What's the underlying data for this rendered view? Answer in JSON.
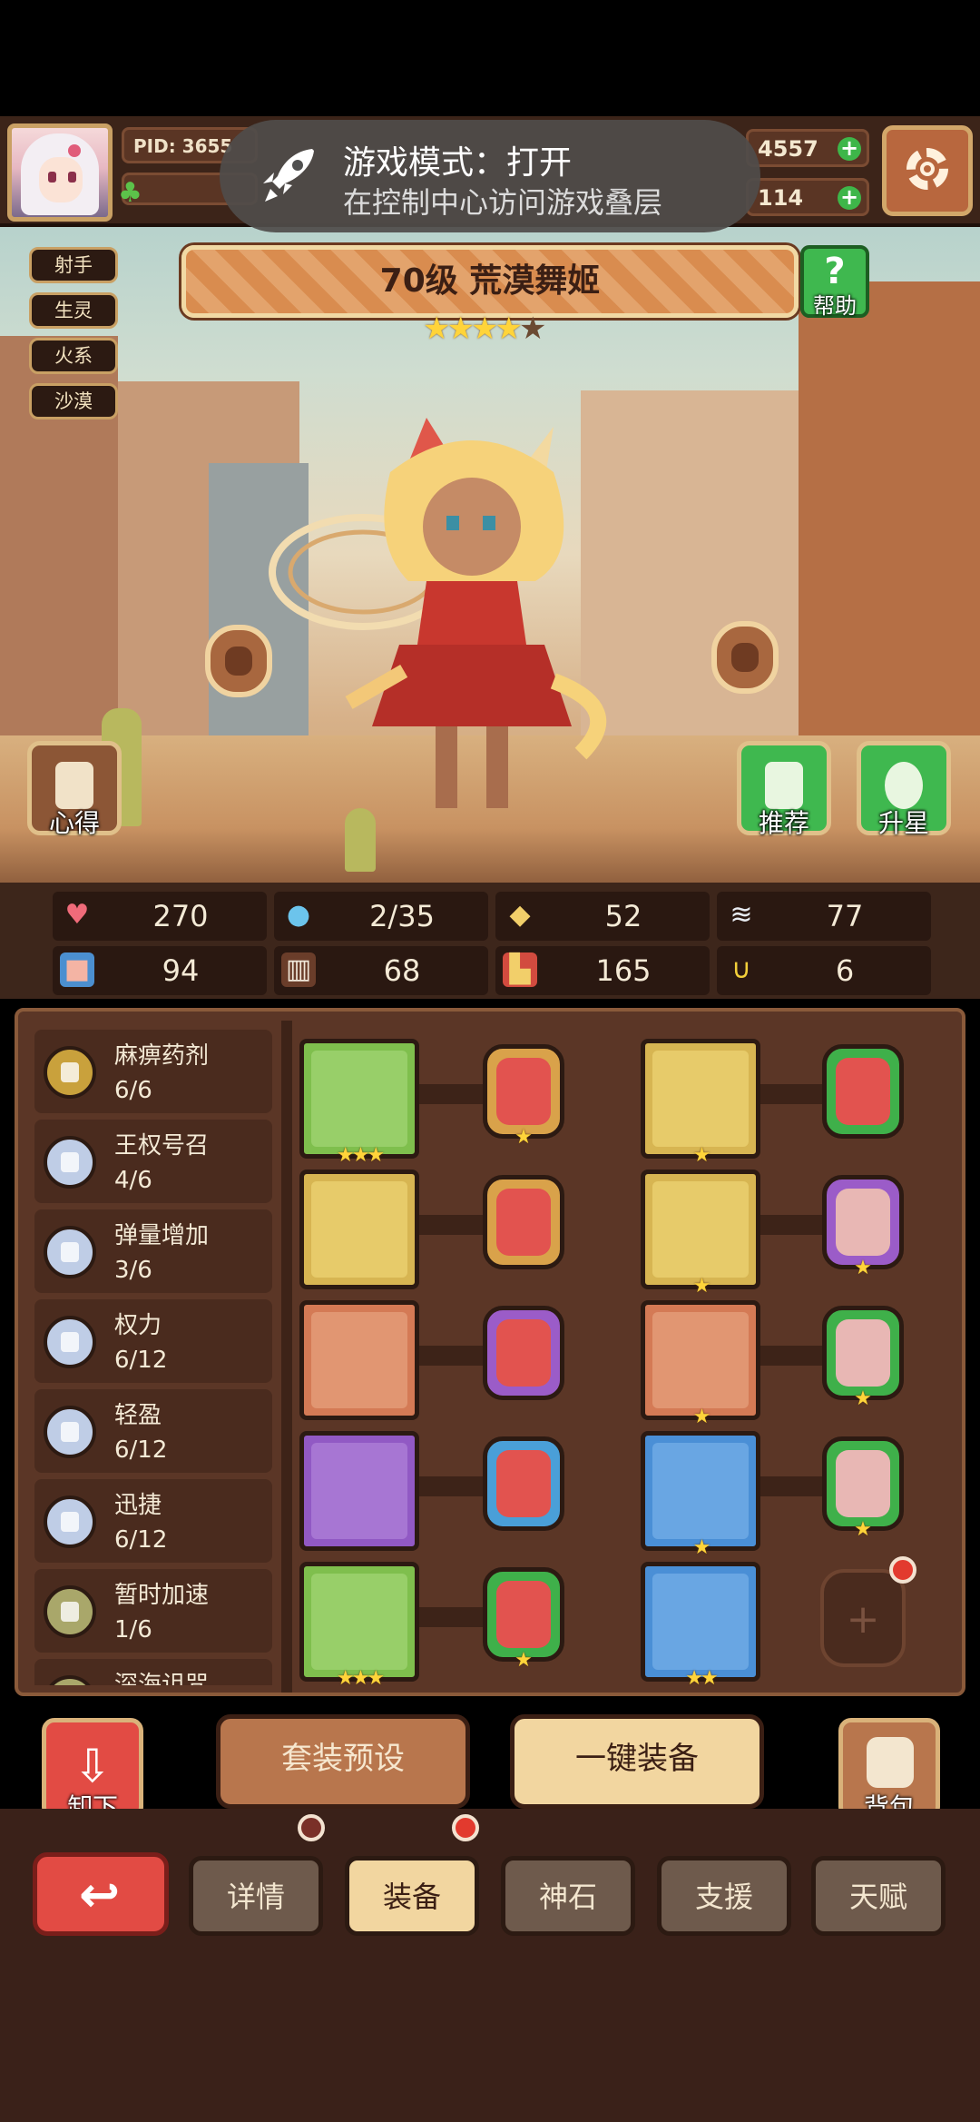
{
  "toast": {
    "title": "游戏模式：打开",
    "subtitle": "在控制中心访问游戏叠层"
  },
  "header": {
    "pid": "PID: 3655",
    "currency1": "4557",
    "currency2": "114"
  },
  "character": {
    "tags": [
      "射手",
      "生灵",
      "火系",
      "沙漠"
    ],
    "title": "70级 荒漠舞姬",
    "stars_filled": 4,
    "stars_total": 5,
    "help_label": "帮助",
    "insight_label": "心得",
    "recommend_label": "推荐",
    "upgrade_label": "升星"
  },
  "stats": [
    {
      "icon": "heart-icon",
      "value": "270"
    },
    {
      "icon": "water-drop-icon",
      "value": "2/35"
    },
    {
      "icon": "shield-icon",
      "value": "52"
    },
    {
      "icon": "wing-icon",
      "value": "77"
    },
    {
      "icon": "fist-icon",
      "value": "94"
    },
    {
      "icon": "book-icon",
      "value": "68"
    },
    {
      "icon": "boot-icon",
      "value": "165"
    },
    {
      "icon": "horseshoe-icon",
      "value": "6"
    }
  ],
  "skills": [
    {
      "name": "麻痹药剂",
      "count": "6/6",
      "color": "#c9a13c"
    },
    {
      "name": "王权号召",
      "count": "4/6",
      "color": "#bfcde6"
    },
    {
      "name": "弹量增加",
      "count": "3/6",
      "color": "#bfcde6"
    },
    {
      "name": "权力",
      "count": "6/12",
      "color": "#bfcde6"
    },
    {
      "name": "轻盈",
      "count": "6/12",
      "color": "#bfcde6"
    },
    {
      "name": "迅捷",
      "count": "6/12",
      "color": "#bfcde6"
    },
    {
      "name": "暂时加速",
      "count": "1/6",
      "color": "#a9a76a"
    },
    {
      "name": "深海诅咒",
      "count": "",
      "color": "#a9a76a"
    }
  ],
  "equipment": [
    {
      "item": "wand-icon",
      "frame": "#7fbf4d",
      "inner": "#9ad06a",
      "stars": "★★★",
      "gem_border": "#d9a24a",
      "gem": "#e2534f",
      "gem_star": "★"
    },
    {
      "item": "crown-icon",
      "frame": "#d7b552",
      "inner": "#e8cc6c",
      "stars": "★",
      "gem_border": "#3fb04a",
      "gem": "#e2534f",
      "gem_star": ""
    },
    {
      "item": "spear-icon",
      "frame": "#d7b552",
      "inner": "#e8cc6c",
      "stars": "",
      "gem_border": "#d9a24a",
      "gem": "#e2534f",
      "gem_star": ""
    },
    {
      "item": "robe-icon",
      "frame": "#d7b552",
      "inner": "#e8cc6c",
      "stars": "★",
      "gem_border": "#9b5cc8",
      "gem": "#e8b7b4",
      "gem_star": "★"
    },
    {
      "item": "necklace-icon",
      "frame": "#d47a55",
      "inner": "#e29874",
      "stars": "",
      "gem_border": "#9b5cc8",
      "gem": "#e2534f",
      "gem_star": ""
    },
    {
      "item": "ring-icon",
      "frame": "#d47a55",
      "inner": "#e29874",
      "stars": "★",
      "gem_border": "#3fb04a",
      "gem": "#e8b7b4",
      "gem_star": "★"
    },
    {
      "item": "amulet-icon",
      "frame": "#9159c4",
      "inner": "#a978d4",
      "stars": "",
      "gem_border": "#4a9fd8",
      "gem": "#e2534f",
      "gem_star": ""
    },
    {
      "item": "belt-icon",
      "frame": "#4a8fd6",
      "inner": "#6aa8e4",
      "stars": "★",
      "gem_border": "#3fb04a",
      "gem": "#e8b7b4",
      "gem_star": "★"
    },
    {
      "item": "bracer-icon",
      "frame": "#7fbf4d",
      "inner": "#9ad06a",
      "stars": "★★★",
      "gem_border": "#3fb04a",
      "gem": "#e2534f",
      "gem_star": "★"
    },
    {
      "item": "boots-icon",
      "frame": "#4a8fd6",
      "inner": "#6aa8e4",
      "stars": "★★",
      "gem_border": "",
      "gem": "",
      "gem_star": ""
    }
  ],
  "actions": {
    "unequip": "卸下",
    "preset": "套装预设",
    "equip_all": "一键装备",
    "bag": "背包"
  },
  "nav": {
    "tabs": [
      "详情",
      "装备",
      "神石",
      "支援",
      "天赋"
    ],
    "active": "装备"
  }
}
